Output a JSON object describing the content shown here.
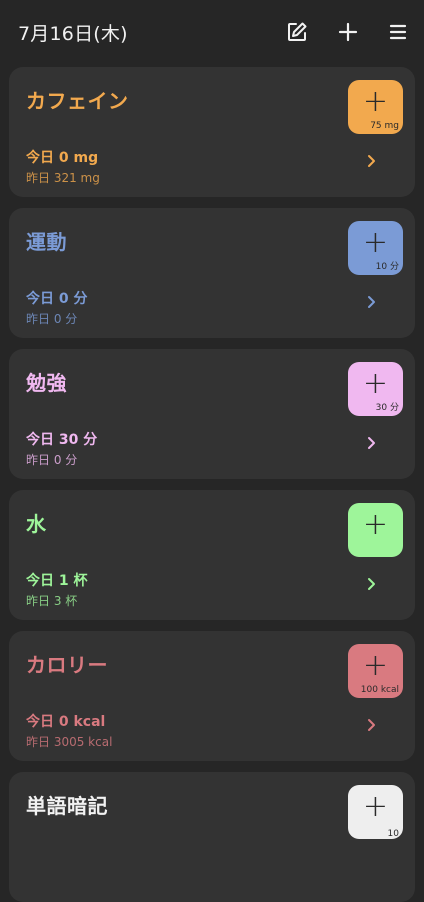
{
  "header": {
    "date": "7月16日(木)"
  },
  "cards": [
    {
      "title": "カフェイン",
      "today": "今日 0 mg",
      "yesterday": "昨日 321 mg",
      "amount": "75 mg",
      "color": "#f2a94e"
    },
    {
      "title": "運動",
      "today": "今日 0 分",
      "yesterday": "昨日 0 分",
      "amount": "10 分",
      "color": "#7b9bd6"
    },
    {
      "title": "勉強",
      "today": "今日 30 分",
      "yesterday": "昨日 0 分",
      "amount": "30 分",
      "color": "#f0b8f0"
    },
    {
      "title": "水",
      "today": "今日 1 杯",
      "yesterday": "昨日 3 杯",
      "amount": "",
      "color": "#9ef59a"
    },
    {
      "title": "カロリー",
      "today": "今日 0 kcal",
      "yesterday": "昨日 3005 kcal",
      "amount": "100 kcal",
      "color": "#d97a80"
    },
    {
      "title": "単語暗記",
      "amount": "10",
      "color": "#eeeeee"
    }
  ],
  "icons": {
    "edit": "edit-icon",
    "add": "plus-icon",
    "menu": "menu-icon",
    "chevron": "chevron-right-icon"
  }
}
